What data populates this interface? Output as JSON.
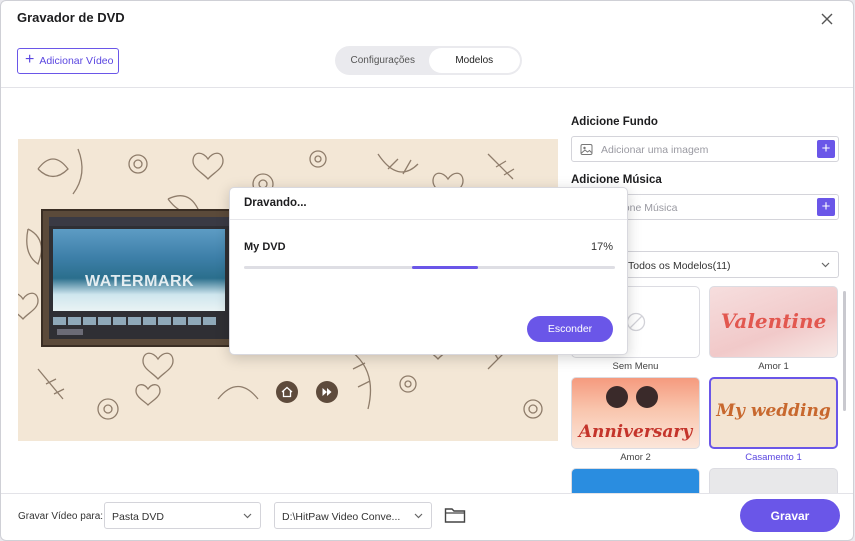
{
  "window": {
    "title": "Gravador de DVD"
  },
  "toolbar": {
    "add_video_label": "Adicionar Vídeo"
  },
  "tabs": [
    {
      "label": "Configurações"
    },
    {
      "label": "Modelos"
    }
  ],
  "preview": {
    "watermark_text": "WATERMARK"
  },
  "background": {
    "label": "Adicione Fundo",
    "placeholder": "Adicionar uma imagem"
  },
  "music": {
    "label": "Adicione Música",
    "placeholder": "Adicione Música"
  },
  "templates_filter": {
    "value": "Todos os Modelos(11)"
  },
  "templates": [
    {
      "caption": "Sem Menu",
      "art": ""
    },
    {
      "caption": "Amor 1",
      "art": "Valentine"
    },
    {
      "caption": "Amor 2",
      "art": "Anniversary"
    },
    {
      "caption": "Casamento 1",
      "art": "My wedding"
    }
  ],
  "bottom": {
    "save_to_label": "Gravar Vídeo para:",
    "target_value": "Pasta DVD",
    "path_value": "D:\\HitPaw Video Conve...",
    "burn_label": "Gravar"
  },
  "dialog": {
    "title": "Dravando...",
    "item_name": "My DVD",
    "percent": "17%",
    "progress": 0.17,
    "hide_label": "Esconder"
  },
  "colors": {
    "accent": "#6a56e8",
    "preview_bg": "#f3e7d6"
  }
}
